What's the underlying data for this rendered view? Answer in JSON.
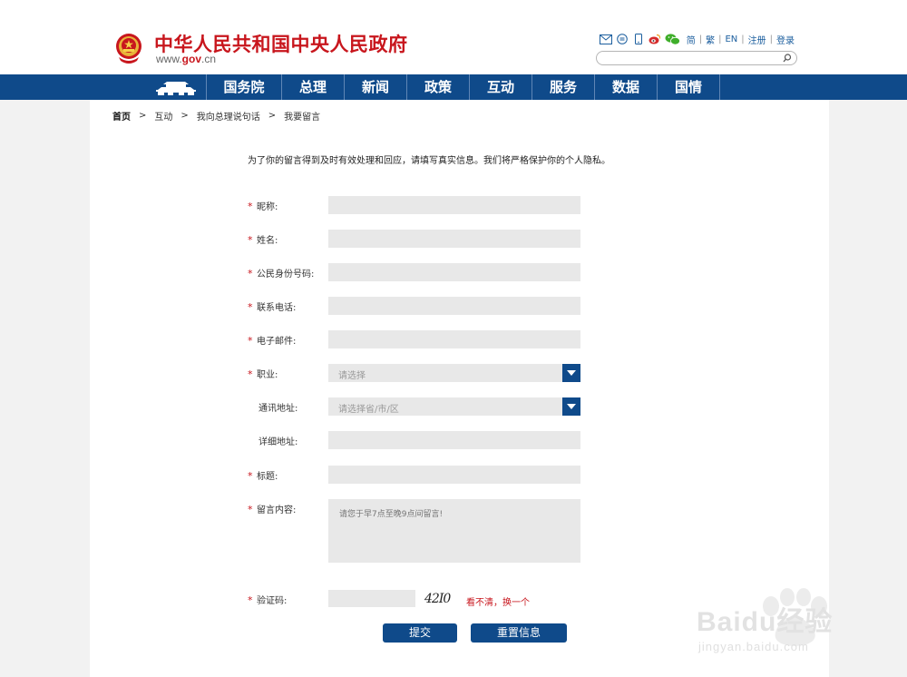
{
  "header": {
    "title": "中华人民共和国中央人民政府",
    "url_prefix": "www.",
    "url_brand": "gov",
    "url_suffix": ".cn",
    "links": {
      "simplified": "简",
      "traditional": "繁",
      "english": "EN",
      "register": "注册",
      "login": "登录"
    },
    "search_placeholder": ""
  },
  "nav": {
    "items": [
      "国务院",
      "总理",
      "新闻",
      "政策",
      "互动",
      "服务",
      "数据",
      "国情"
    ]
  },
  "breadcrumb": {
    "items": [
      "首页",
      "互动",
      "我向总理说句话",
      "我要留言"
    ]
  },
  "form": {
    "intro": "为了你的留言得到及时有效处理和回应，请填写真实信息。我们将严格保护你的个人隐私。",
    "fields": {
      "nickname": {
        "label": "昵称:",
        "value": ""
      },
      "name": {
        "label": "姓名:",
        "value": ""
      },
      "id_number": {
        "label": "公民身份号码:",
        "value": ""
      },
      "phone": {
        "label": "联系电话:",
        "value": ""
      },
      "email": {
        "label": "电子邮件:",
        "value": ""
      },
      "occupation": {
        "label": "职业:",
        "placeholder": "请选择"
      },
      "address_region": {
        "label": "通讯地址:",
        "placeholder": "请选择省/市/区"
      },
      "address_detail": {
        "label": "详细地址:",
        "value": ""
      },
      "title": {
        "label": "标题:",
        "value": ""
      },
      "content": {
        "label": "留言内容:",
        "placeholder": "请您于早7点至晚9点间留言!"
      },
      "captcha": {
        "label": "验证码:",
        "value": "",
        "image_text": "42I0",
        "refresh": "看不清，换一个"
      }
    },
    "required_mark": "*",
    "submit_label": "提交",
    "reset_label": "重置信息"
  },
  "watermark": {
    "text": "Baidu经验",
    "sub": "jingyan.baidu.com"
  },
  "colors": {
    "brand_red": "#c8161d",
    "nav_blue": "#0f4a8a",
    "input_gray": "#e8e8e8"
  }
}
